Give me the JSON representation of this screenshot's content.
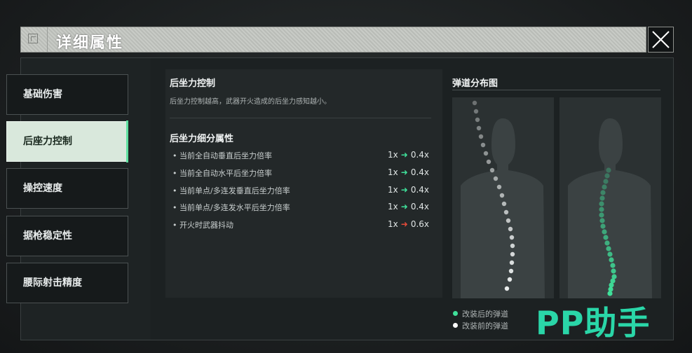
{
  "window": {
    "title": "详细属性",
    "close_icon": "close-icon"
  },
  "sidebar": {
    "items": [
      {
        "label": "基础伤害",
        "active": false
      },
      {
        "label": "后座力控制",
        "active": true
      },
      {
        "label": "操控速度",
        "active": false
      },
      {
        "label": "据枪稳定性",
        "active": false
      },
      {
        "label": "腰际射击精度",
        "active": false
      }
    ]
  },
  "detail": {
    "heading": "后坐力控制",
    "description": "后坐力控制越高，武器开火造成的后坐力感知越小。",
    "sub_heading": "后坐力细分属性",
    "attributes": [
      {
        "label": "• 当前全自动垂直后坐力倍率",
        "before": "1x",
        "after": "0.4x",
        "trend": "improve"
      },
      {
        "label": "• 当前全自动水平后坐力倍率",
        "before": "1x",
        "after": "0.4x",
        "trend": "improve"
      },
      {
        "label": "• 当前单点/多连发垂直后坐力倍率",
        "before": "1x",
        "after": "0.4x",
        "trend": "improve"
      },
      {
        "label": "• 当前单点/多连发水平后坐力倍率",
        "before": "1x",
        "after": "0.4x",
        "trend": "improve"
      },
      {
        "label": "• 开火时武器抖动",
        "before": "1x",
        "after": "0.6x",
        "trend": "worse"
      }
    ]
  },
  "ballistics": {
    "title": "弹道分布图",
    "legend": [
      {
        "label": "改装后的弹道",
        "color": "#3fe09a"
      },
      {
        "label": "改装前的弹道",
        "color": "#ffffff"
      }
    ]
  },
  "colors": {
    "accent_green": "#3fe09a",
    "accent_red": "#e54b3a"
  },
  "watermark": "PP助手"
}
